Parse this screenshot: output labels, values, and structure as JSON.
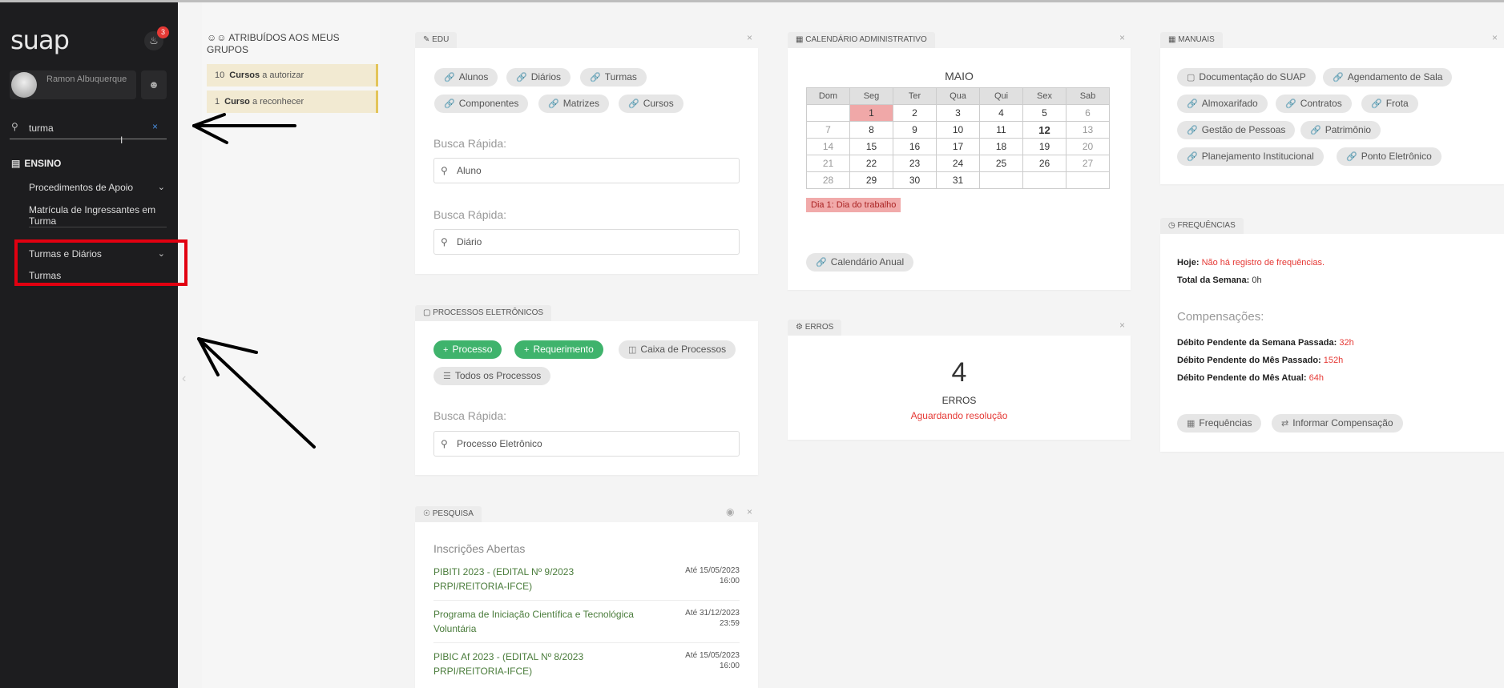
{
  "sidebar": {
    "logo": "suap",
    "notif_count": "3",
    "user_name": "Ramon Albuquerque",
    "search_value": "turma",
    "search_clear": "×",
    "ensino_label": "ENSINO",
    "procedimentos": "Procedimentos de Apoio",
    "matricula": "Matrícula de Ingressantes em Turma",
    "turmas_diarios": "Turmas e Diários",
    "turmas": "Turmas",
    "collapse": "‹"
  },
  "groups": {
    "title": "ATRIBUÍDOS AOS MEUS GRUPOS",
    "items": [
      {
        "count": "10",
        "bold": "Cursos",
        "rest": "a autorizar"
      },
      {
        "count": "1",
        "bold": "Curso",
        "rest": "a reconhecer"
      }
    ]
  },
  "edu": {
    "tab": "EDU",
    "pills": [
      "Alunos",
      "Diários",
      "Turmas",
      "Componentes",
      "Matrizes",
      "Cursos"
    ],
    "quick_label": "Busca Rápida:",
    "search1": "Aluno",
    "search2": "Diário"
  },
  "processos": {
    "tab": "PROCESSOS ELETRÔNICOS",
    "btn_processo": "Processo",
    "btn_requerimento": "Requerimento",
    "btn_caixa": "Caixa de Processos",
    "btn_todos": "Todos os Processos",
    "quick_label": "Busca Rápida:",
    "search": "Processo Eletrônico"
  },
  "pesquisa": {
    "tab": "PESQUISA",
    "heading": "Inscrições Abertas",
    "items": [
      {
        "title": "PIBITI 2023 - (EDITAL Nº 9/2023 PRPI/REITORIA-IFCE)",
        "date": "Até 15/05/2023 16:00"
      },
      {
        "title": "Programa de Iniciação Científica e Tecnológica Voluntária",
        "date": "Até 31/12/2023 23:59"
      },
      {
        "title": "PIBIC Af 2023 - (EDITAL Nº 8/2023 PRPI/REITORIA-IFCE)",
        "date": "Até 15/05/2023 16:00"
      }
    ]
  },
  "calendario": {
    "tab": "CALENDÁRIO ADMINISTRATIVO",
    "month": "MAIO",
    "weekdays": [
      "Dom",
      "Seg",
      "Ter",
      "Qua",
      "Qui",
      "Sex",
      "Sab"
    ],
    "weeks": [
      [
        "",
        "1",
        "2",
        "3",
        "4",
        "5",
        "6"
      ],
      [
        "7",
        "8",
        "9",
        "10",
        "11",
        "12",
        "13"
      ],
      [
        "14",
        "15",
        "16",
        "17",
        "18",
        "19",
        "20"
      ],
      [
        "21",
        "22",
        "23",
        "24",
        "25",
        "26",
        "27"
      ],
      [
        "28",
        "29",
        "30",
        "31",
        "",
        "",
        ""
      ]
    ],
    "holiday": "Dia 1: Dia do trabalho",
    "annual_btn": "Calendário Anual"
  },
  "erros": {
    "tab": "ERROS",
    "count": "4",
    "label": "ERROS",
    "status": "Aguardando resolução"
  },
  "manuais": {
    "tab": "MANUAIS",
    "pills": [
      "Documentação do SUAP",
      "Agendamento de Sala",
      "Almoxarifado",
      "Contratos",
      "Frota",
      "Gestão de Pessoas",
      "Patrimônio",
      "Planejamento Institucional",
      "Ponto Eletrônico"
    ]
  },
  "frequencias": {
    "tab": "FREQUÊNCIAS",
    "hoje_label": "Hoje:",
    "hoje_value": "Não há registro de frequências.",
    "total_label": "Total da Semana:",
    "total_value": "0h",
    "comp_heading": "Compensações:",
    "debito_semana_label": "Débito Pendente da Semana Passada:",
    "debito_semana_value": "32h",
    "debito_mes_label": "Débito Pendente do Mês Passado:",
    "debito_mes_value": "152h",
    "debito_atual_label": "Débito Pendente do Mês Atual:",
    "debito_atual_value": "64h",
    "btn_freq": "Frequências",
    "btn_comp": "Informar Compensação"
  },
  "colors": {
    "sidebar_bg": "#1d1d1f",
    "accent_green": "#3fb36c",
    "alert_red": "#e53935",
    "highlight_box": "#e10010"
  }
}
